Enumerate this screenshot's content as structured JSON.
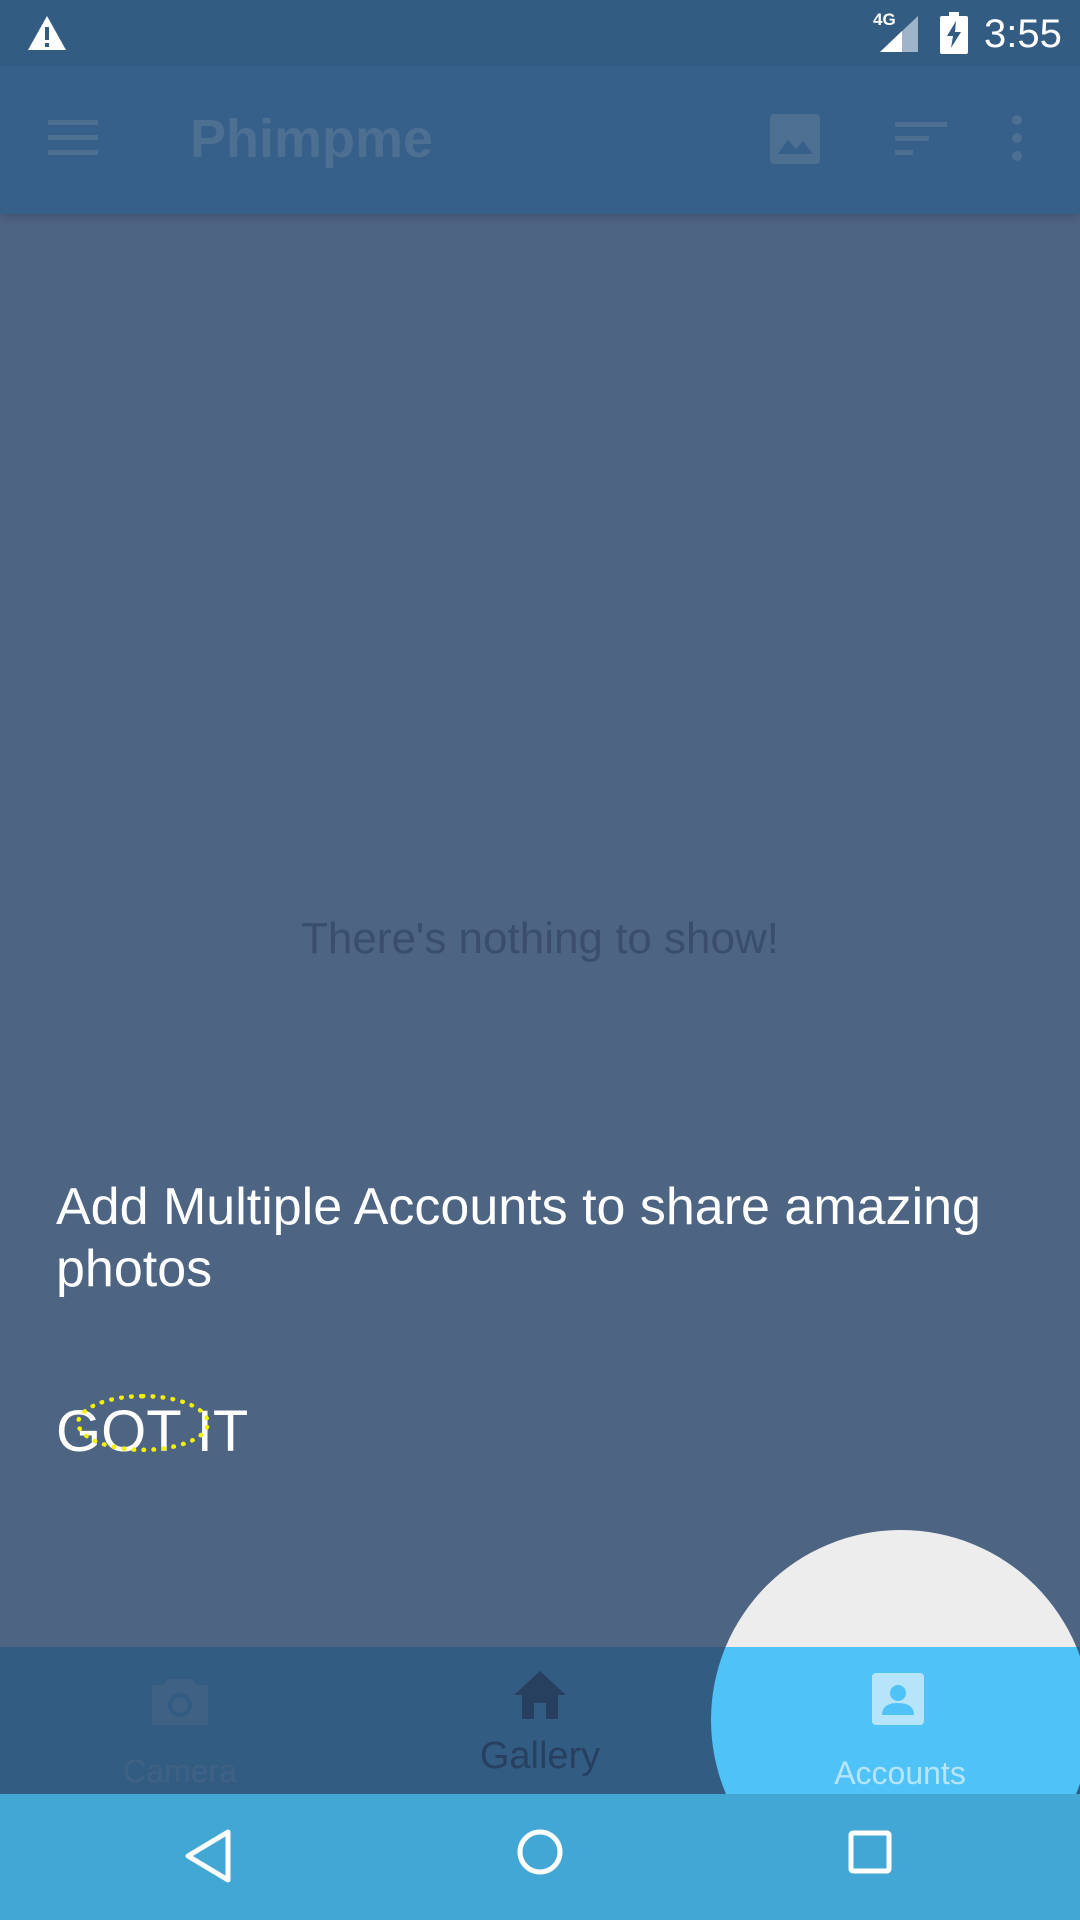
{
  "status_bar": {
    "network_type": "4G",
    "time": "3:55",
    "icons": [
      "warning-icon",
      "signal-icon",
      "battery-charging-icon"
    ]
  },
  "toolbar": {
    "title": "Phimpme",
    "icons": [
      "menu-icon",
      "image-icon",
      "sort-icon",
      "more-vert-icon"
    ]
  },
  "content": {
    "empty_message": "There's nothing to show!"
  },
  "tutorial": {
    "message": "Add Multiple Accounts to share amazing photos",
    "dismiss_label": "GOT IT"
  },
  "bottom_nav": {
    "items": [
      {
        "label": "Camera",
        "icon": "camera-icon"
      },
      {
        "label": "Gallery",
        "icon": "home-icon"
      },
      {
        "label": "Accounts",
        "icon": "account-box-icon"
      }
    ]
  },
  "system_nav": {
    "icons": [
      "back-icon",
      "home-circle-icon",
      "recent-apps-icon"
    ]
  },
  "colors": {
    "overlay": "#4e6483",
    "status_bar": "#335c83",
    "toolbar": "#365f89",
    "accent": "#4fc3f7",
    "spotlight": "#ededee",
    "system_nav": "#43a7d6",
    "marker": "#f5f200"
  }
}
